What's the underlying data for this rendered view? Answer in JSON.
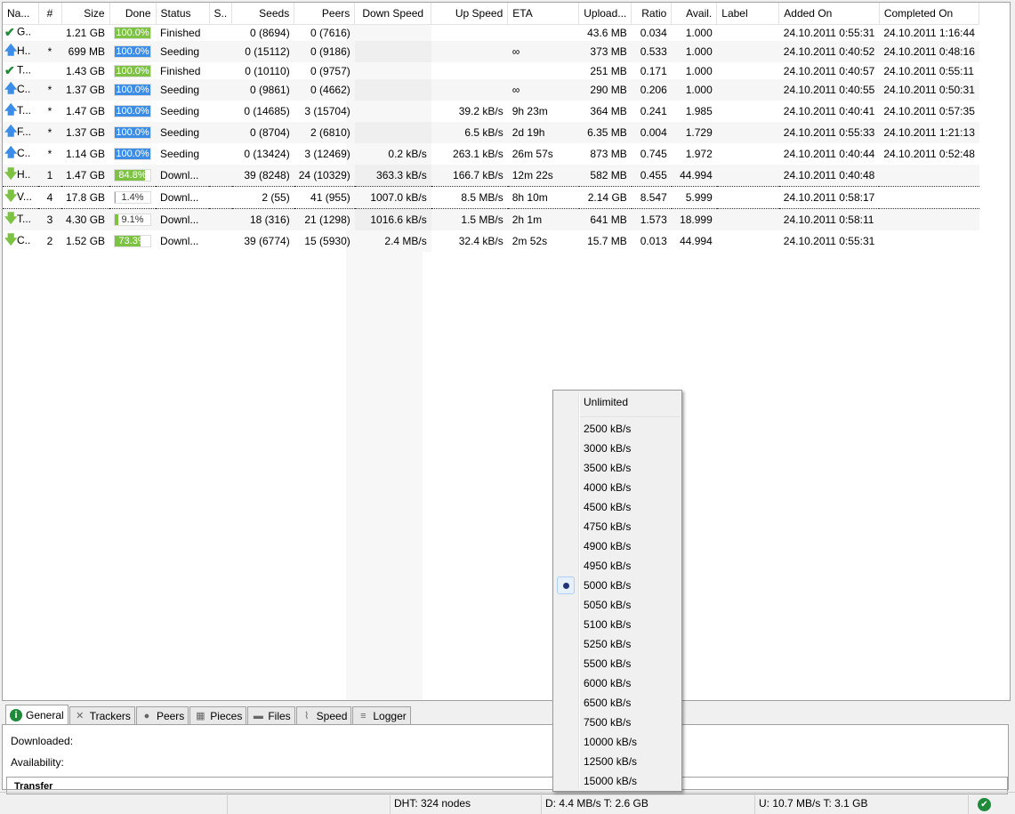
{
  "columns": [
    "Na...",
    "#",
    "Size",
    "Done",
    "Status",
    "S..",
    "Seeds",
    "Peers",
    "Down Speed",
    "Up Speed",
    "ETA",
    "Upload...",
    "Ratio",
    "Avail.",
    "Label",
    "Added On",
    "Completed On"
  ],
  "rows": [
    {
      "icon": "check",
      "name": "G..",
      "num": "",
      "size": "1.21 GB",
      "done": "100.0%",
      "pct": 100,
      "bar": "#7dc243",
      "status": "Finished",
      "seeds": "0 (8694)",
      "peers": "0 (7616)",
      "down": "",
      "up": "",
      "eta": "",
      "uploaded": "43.6 MB",
      "ratio": "0.034",
      "avail": "1.000",
      "added": "24.10.2011 0:55:31",
      "completed": "24.10.2011 1:16:44"
    },
    {
      "icon": "up",
      "name": "H..",
      "num": "*",
      "size": "699 MB",
      "done": "100.0%",
      "pct": 100,
      "bar": "#3c8de8",
      "status": "Seeding",
      "seeds": "0 (15112)",
      "peers": "0 (9186)",
      "down": "",
      "up": "",
      "eta": "∞",
      "uploaded": "373 MB",
      "ratio": "0.533",
      "avail": "1.000",
      "added": "24.10.2011 0:40:52",
      "completed": "24.10.2011 0:48:16"
    },
    {
      "icon": "check",
      "name": "T...",
      "num": "",
      "size": "1.43 GB",
      "done": "100.0%",
      "pct": 100,
      "bar": "#7dc243",
      "status": "Finished",
      "seeds": "0 (10110)",
      "peers": "0 (9757)",
      "down": "",
      "up": "",
      "eta": "",
      "uploaded": "251 MB",
      "ratio": "0.171",
      "avail": "1.000",
      "added": "24.10.2011 0:40:57",
      "completed": "24.10.2011 0:55:11"
    },
    {
      "icon": "up",
      "name": "C..",
      "num": "*",
      "size": "1.37 GB",
      "done": "100.0%",
      "pct": 100,
      "bar": "#3c8de8",
      "status": "Seeding",
      "seeds": "0 (9861)",
      "peers": "0 (4662)",
      "down": "",
      "up": "",
      "eta": "∞",
      "uploaded": "290 MB",
      "ratio": "0.206",
      "avail": "1.000",
      "added": "24.10.2011 0:40:55",
      "completed": "24.10.2011 0:50:31"
    },
    {
      "icon": "up",
      "name": "T...",
      "num": "*",
      "size": "1.47 GB",
      "done": "100.0%",
      "pct": 100,
      "bar": "#3c8de8",
      "status": "Seeding",
      "seeds": "0 (14685)",
      "peers": "3 (15704)",
      "down": "",
      "up": "39.2 kB/s",
      "eta": "9h 23m",
      "uploaded": "364 MB",
      "ratio": "0.241",
      "avail": "1.985",
      "added": "24.10.2011 0:40:41",
      "completed": "24.10.2011 0:57:35"
    },
    {
      "icon": "up",
      "name": "F...",
      "num": "*",
      "size": "1.37 GB",
      "done": "100.0%",
      "pct": 100,
      "bar": "#3c8de8",
      "status": "Seeding",
      "seeds": "0 (8704)",
      "peers": "2 (6810)",
      "down": "",
      "up": "6.5 kB/s",
      "eta": "2d 19h",
      "uploaded": "6.35 MB",
      "ratio": "0.004",
      "avail": "1.729",
      "added": "24.10.2011 0:55:33",
      "completed": "24.10.2011 1:21:13"
    },
    {
      "icon": "up",
      "name": "C..",
      "num": "*",
      "size": "1.14 GB",
      "done": "100.0%",
      "pct": 100,
      "bar": "#3c8de8",
      "status": "Seeding",
      "seeds": "0 (13424)",
      "peers": "3 (12469)",
      "down": "0.2 kB/s",
      "up": "263.1 kB/s",
      "eta": "26m 57s",
      "uploaded": "873 MB",
      "ratio": "0.745",
      "avail": "1.972",
      "added": "24.10.2011 0:40:44",
      "completed": "24.10.2011 0:52:48"
    },
    {
      "icon": "down",
      "name": "H..",
      "num": "1",
      "size": "1.47 GB",
      "done": "84.8%",
      "pct": 84.8,
      "bar": "#7dc243",
      "status": "Downl...",
      "seeds": "39 (8248)",
      "peers": "24 (10329)",
      "down": "363.3 kB/s",
      "up": "166.7 kB/s",
      "eta": "12m 22s",
      "uploaded": "582 MB",
      "ratio": "0.455",
      "avail": "44.994",
      "added": "24.10.2011 0:40:48",
      "completed": ""
    },
    {
      "icon": "down",
      "name": "V...",
      "num": "4",
      "size": "17.8 GB",
      "done": "1.4%",
      "pct": 1.4,
      "bar": "#7dc243",
      "status": "Downl...",
      "seeds": "2 (55)",
      "peers": "41 (955)",
      "down": "1007.0 kB/s",
      "up": "8.5 MB/s",
      "eta": "8h 10m",
      "uploaded": "2.14 GB",
      "ratio": "8.547",
      "avail": "5.999",
      "added": "24.10.2011 0:58:17",
      "completed": ""
    },
    {
      "icon": "down",
      "name": "T...",
      "num": "3",
      "size": "4.30 GB",
      "done": "9.1%",
      "pct": 9.1,
      "bar": "#7dc243",
      "status": "Downl...",
      "seeds": "18 (316)",
      "peers": "21 (1298)",
      "down": "1016.6 kB/s",
      "up": "1.5 MB/s",
      "eta": "2h 1m",
      "uploaded": "641 MB",
      "ratio": "1.573",
      "avail": "18.999",
      "added": "24.10.2011 0:58:11",
      "completed": ""
    },
    {
      "icon": "down",
      "name": "C..",
      "num": "2",
      "size": "1.52 GB",
      "done": "73.3%",
      "pct": 73.3,
      "bar": "#7dc243",
      "status": "Downl...",
      "seeds": "39 (6774)",
      "peers": "15 (5930)",
      "down": "2.4 MB/s",
      "up": "32.4 kB/s",
      "eta": "2m 52s",
      "uploaded": "15.7 MB",
      "ratio": "0.013",
      "avail": "44.994",
      "added": "24.10.2011 0:55:31",
      "completed": ""
    }
  ],
  "tabs": [
    "General",
    "Trackers",
    "Peers",
    "Pieces",
    "Files",
    "Speed",
    "Logger"
  ],
  "general": {
    "downloaded": "Downloaded:",
    "availability": "Availability:",
    "transfer": "Transfer"
  },
  "status": {
    "dht": "DHT: 324 nodes",
    "down": "D: 4.4 MB/s T: 2.6 GB",
    "up": "U: 10.7 MB/s T: 3.1 GB"
  },
  "menu": {
    "unlimited": "Unlimited",
    "items": [
      "2500 kB/s",
      "3000 kB/s",
      "3500 kB/s",
      "4000 kB/s",
      "4500 kB/s",
      "4750 kB/s",
      "4900 kB/s",
      "4950 kB/s",
      "5000 kB/s",
      "5050 kB/s",
      "5100 kB/s",
      "5250 kB/s",
      "5500 kB/s",
      "6000 kB/s",
      "6500 kB/s",
      "7500 kB/s",
      "10000 kB/s",
      "12500 kB/s",
      "15000 kB/s"
    ],
    "selected": "5000 kB/s"
  }
}
